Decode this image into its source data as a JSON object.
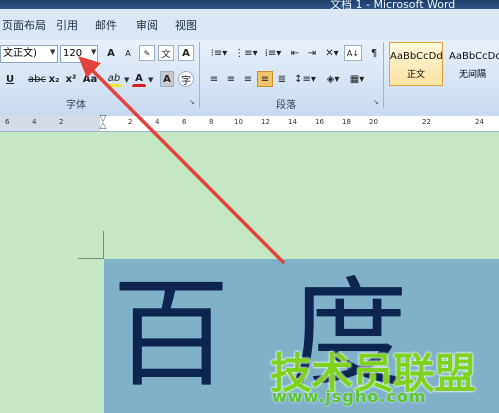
{
  "window": {
    "title": "文档 1 - Microsoft Word"
  },
  "menu": [
    "页面布局",
    "引用",
    "邮件",
    "审阅",
    "视图"
  ],
  "font": {
    "name_value": "文正文)",
    "size_value": "120",
    "grow_label": "A",
    "shrink_label": "A",
    "group_label": "字体",
    "underline": "U",
    "strike": "abc",
    "subscript": "x₂",
    "superscript": "x²",
    "change_case": "Aa",
    "highlight": "ab",
    "color_a": "A",
    "char_shade": "A"
  },
  "paragraph": {
    "group_label": "段落"
  },
  "styles": [
    {
      "sample": "AaBbCcDd",
      "name": "正文"
    },
    {
      "sample": "AaBbCcDd",
      "name": "无间隔"
    }
  ],
  "ruler": {
    "ticks": [
      "6",
      "4",
      "2",
      "2",
      "4",
      "6",
      "8",
      "10",
      "12",
      "14",
      "16",
      "18",
      "20",
      "22",
      "24"
    ]
  },
  "document": {
    "text": "百度"
  },
  "watermark": {
    "brand": "技术员联盟",
    "url": "www.jsgho.com"
  },
  "colors": {
    "arrow": "#e0443b",
    "page_bg": "#c6e7c4",
    "selection": "#7fb2c8",
    "text": "#0d2550"
  }
}
